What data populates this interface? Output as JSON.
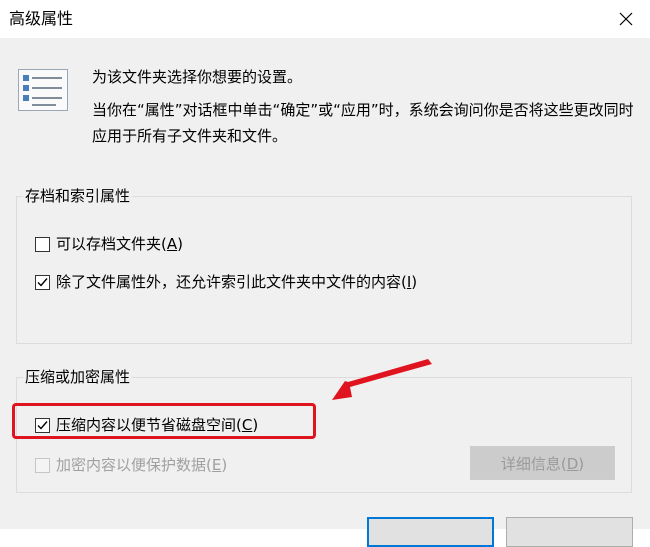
{
  "window": {
    "title": "高级属性"
  },
  "description": {
    "line1": "为该文件夹选择你想要的设置。",
    "line2": "当你在“属性”对话框中单击“确定”或“应用”时，系统会询问你是否将这些更改同时应用于所有子文件夹和文件。"
  },
  "archive_group": {
    "title": "存档和索引属性",
    "archive_checkbox": {
      "label": "可以存档文件夹(",
      "key": "A",
      "suffix": ")",
      "checked": false
    },
    "index_checkbox": {
      "label": "除了文件属性外，还允许索引此文件夹中文件的内容(",
      "key": "I",
      "suffix": ")",
      "checked": true
    }
  },
  "compress_group": {
    "title": "压缩或加密属性",
    "compress_checkbox": {
      "label": "压缩内容以便节省磁盘空间(",
      "key": "C",
      "suffix": ")",
      "checked": true
    },
    "encrypt_checkbox": {
      "label": "加密内容以便保护数据(",
      "key": "E",
      "suffix": ")",
      "checked": false,
      "enabled": false
    },
    "details_button": {
      "label": "详细信息(",
      "key": "D",
      "suffix": ")",
      "enabled": false
    }
  },
  "annotation": {
    "color": "#e0141e"
  },
  "colors": {
    "dialog_bg": "#f0f0f0",
    "accent": "#0078d7"
  },
  "icons": {
    "close": "close-icon",
    "info": "checklist-icon"
  }
}
